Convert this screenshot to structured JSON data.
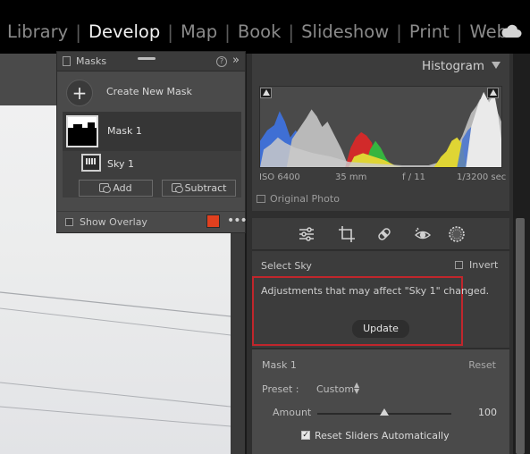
{
  "modules": [
    {
      "label": "Library",
      "active": false
    },
    {
      "label": "Develop",
      "active": true
    },
    {
      "label": "Map",
      "active": false
    },
    {
      "label": "Book",
      "active": false
    },
    {
      "label": "Slideshow",
      "active": false
    },
    {
      "label": "Print",
      "active": false
    },
    {
      "label": "Web",
      "active": false
    }
  ],
  "topbar": {
    "cloud_icon": "cloud-icon"
  },
  "masks_panel": {
    "title": "Masks",
    "create_label": "Create New Mask",
    "mask1_label": "Mask 1",
    "sky1_label": "Sky 1",
    "add_label": "Add",
    "subtract_label": "Subtract",
    "show_overlay_label": "Show Overlay",
    "overlay_color": "#e0401f",
    "help_glyph": "?",
    "collapse_glyph": "»",
    "more_glyph": "•••"
  },
  "histogram": {
    "title": "Histogram",
    "iso": "ISO 6400",
    "focal": "35 mm",
    "aperture": "f / 11",
    "shutter": "1/3200 sec",
    "original_photo_label": "Original Photo"
  },
  "mask_tools": {
    "icons": [
      "sliders-icon",
      "crop-icon",
      "healing-icon",
      "red-eye-icon",
      "masking-icon"
    ]
  },
  "sky_section": {
    "select_label": "Select Sky",
    "invert_label": "Invert",
    "warning_text": "Adjustments that may affect \"Sky 1\" changed.",
    "update_label": "Update",
    "warning_border_color": "#c0262c"
  },
  "mask_adjust": {
    "title": "Mask 1",
    "reset_label": "Reset",
    "preset_label": "Preset :",
    "preset_value": "Custom",
    "amount_label": "Amount",
    "amount_value": "100",
    "reset_sliders_label": "Reset Sliders Automatically",
    "reset_sliders_checked": true
  }
}
